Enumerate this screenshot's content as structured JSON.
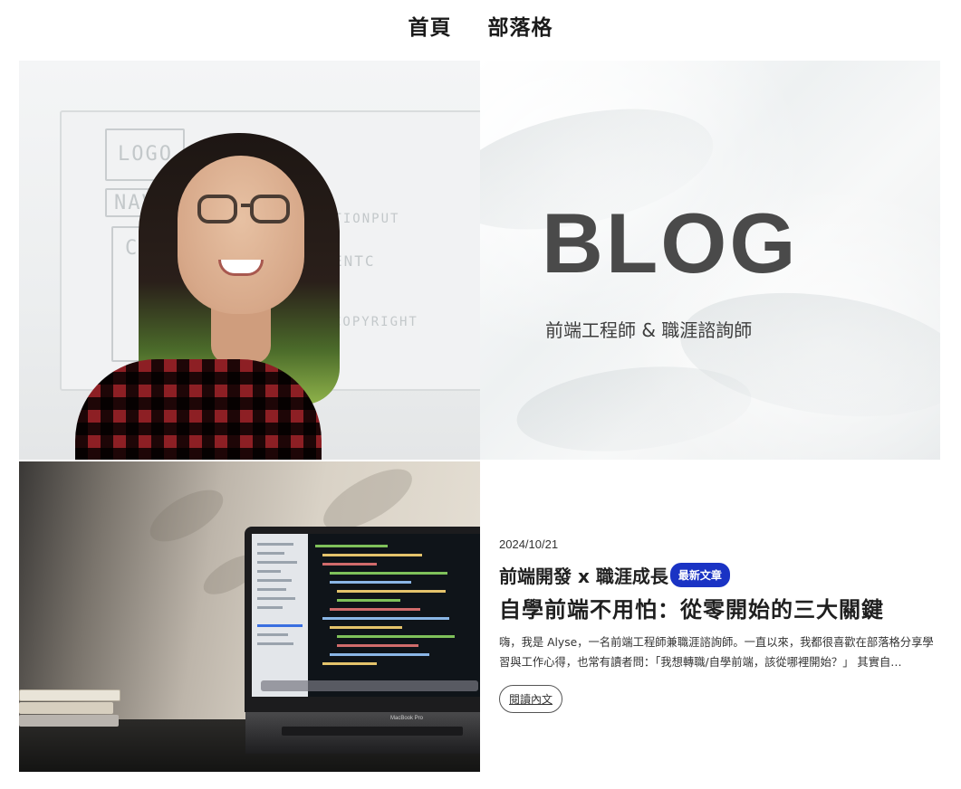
{
  "nav": {
    "items": [
      "首頁",
      "部落格"
    ]
  },
  "hero": {
    "title": "BLOG",
    "subtitle": "前端工程師 & 職涯諮詢師",
    "whiteboard_words": [
      "LOGO",
      "NAVB",
      "CONT",
      "ENTC",
      "ITIONPUT",
      "COPYRIGHT"
    ],
    "laptop_brand": "MacBook Pro"
  },
  "post": {
    "date": "2024/10/21",
    "category": "前端開發 x 職涯成長",
    "badge": "最新文章",
    "title": "自學前端不用怕：從零開始的三大關鍵",
    "excerpt": "嗨，我是 Alyse，一名前端工程師兼職涯諮詢師。一直以來，我都很喜歡在部落格分享學習與工作心得，也常有讀者問：「我想轉職/自學前端，該從哪裡開始？」 其實自…",
    "read_more": "閱讀內文"
  },
  "colors": {
    "badge_bg": "#1a33c4",
    "blog_title": "#4a4a4a"
  }
}
